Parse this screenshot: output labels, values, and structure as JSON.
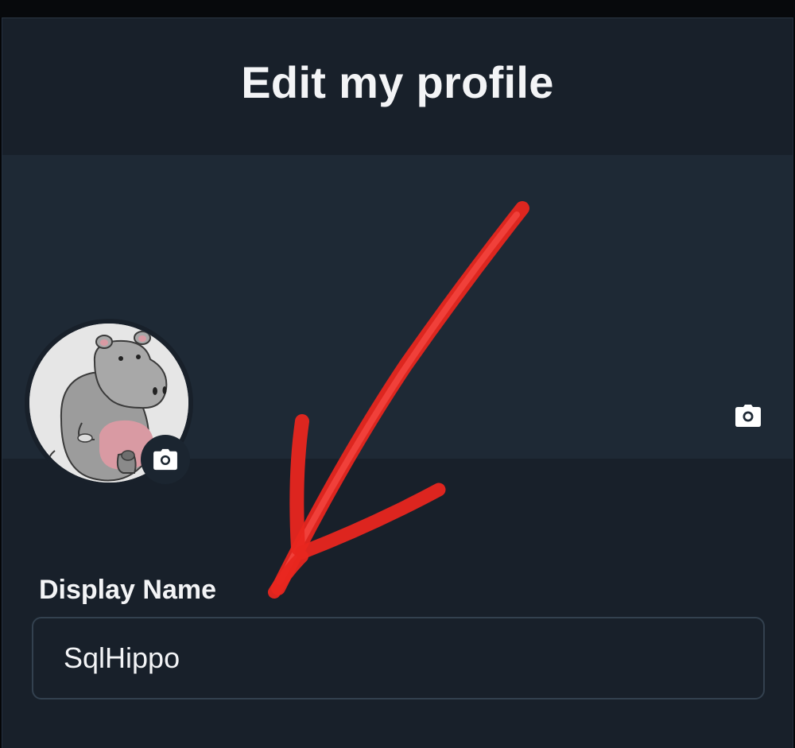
{
  "header": {
    "title": "Edit my profile"
  },
  "banner": {
    "camera_icon": "camera-icon"
  },
  "avatar": {
    "image": "hippo-avatar",
    "camera_icon": "camera-icon"
  },
  "form": {
    "display_name_label": "Display Name",
    "display_name_value": "SqlHippo"
  },
  "annotation": {
    "type": "hand-drawn-arrow",
    "color": "#e8261f"
  },
  "colors": {
    "background": "#18202a",
    "banner": "#1e2935",
    "text": "#f3f4f6",
    "input_border": "#33414f"
  }
}
